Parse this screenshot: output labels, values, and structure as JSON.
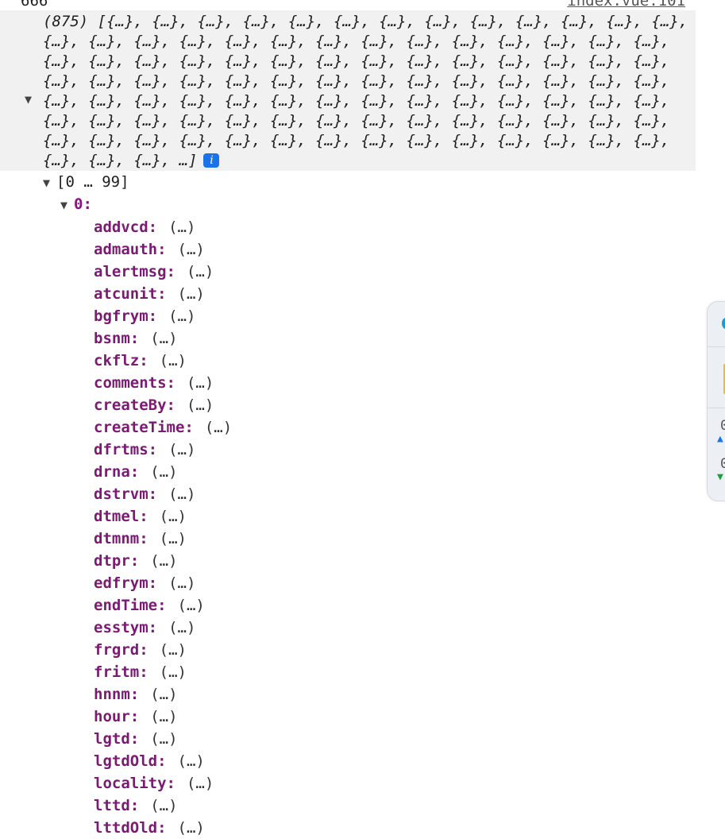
{
  "log": {
    "value": "666",
    "source": "index.vue:101"
  },
  "array": {
    "lines": [
      "(875) [{…}, {…}, {…}, {…}, {…}, {…}, {…}, {…}, {…}, {…}, {…}, {…}, {…},",
      "{…}, {…}, {…}, {…}, {…}, {…}, {…}, {…}, {…}, {…}, {…}, {…}, {…}, {…},",
      "{…}, {…}, {…}, {…}, {…}, {…}, {…}, {…}, {…}, {…}, {…}, {…}, {…}, {…},",
      "{…}, {…}, {…}, {…}, {…}, {…}, {…}, {…}, {…}, {…}, {…}, {…}, {…}, {…},",
      "{…}, {…}, {…}, {…}, {…}, {…}, {…}, {…}, {…}, {…}, {…}, {…}, {…}, {…},",
      "{…}, {…}, {…}, {…}, {…}, {…}, {…}, {…}, {…}, {…}, {…}, {…}, {…}, {…},",
      "{…}, {…}, {…}, {…}, {…}, {…}, {…}, {…}, {…}, {…}, {…}, {…}, {…}, {…},",
      "{…}, {…}, {…}, …]"
    ],
    "info_badge": "i"
  },
  "range_label": "[0 … 99]",
  "index_label": "0:",
  "toggle_glyph": "▼",
  "value_placeholder": "(…)",
  "properties": [
    "addvcd:",
    "admauth:",
    "alertmsg:",
    "atcunit:",
    "bgfrym:",
    "bsnm:",
    "ckflz:",
    "comments:",
    "createBy:",
    "createTime:",
    "dfrtms:",
    "drna:",
    "dstrvm:",
    "dtmel:",
    "dtmnm:",
    "dtpr:",
    "edfrym:",
    "endTime:",
    "esstym:",
    "frgrd:",
    "fritm:",
    "hnnm:",
    "hour:",
    "lgtd:",
    "lgtdOld:",
    "locality:",
    "lttd:",
    "lttdOld:"
  ],
  "side_widget": {
    "text_1": "0",
    "text_2": "0",
    "up_icon": "arrow-up-icon",
    "down_icon": "arrow-down-icon"
  }
}
